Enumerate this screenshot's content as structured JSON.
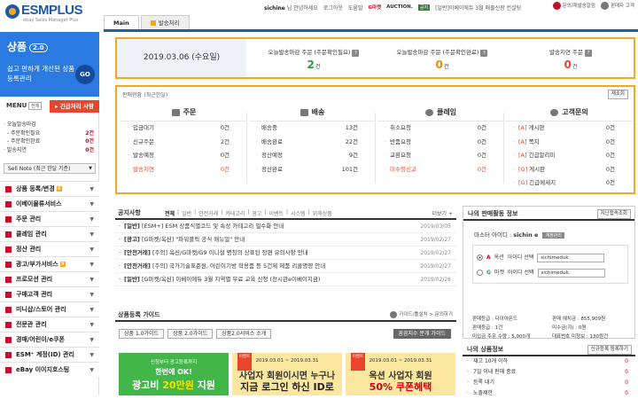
{
  "header": {
    "logo": "ESMPLUS",
    "logo_sub": "ebay Sales Manager Plus",
    "user": "sichine",
    "greeting": "님 안녕하세요",
    "logout": "로그아웃",
    "help": "도움말",
    "partners": [
      "G마켓",
      "AUCTION."
    ],
    "notice_tag": "공지",
    "notice_text": "[일반]이베이에듀 3월 매출신장 컨설팅",
    "links": [
      "문의/재발송알림",
      "판매자 고객"
    ]
  },
  "tabs": [
    {
      "label": "Main",
      "active": true
    },
    {
      "label": "발송처리",
      "active": false
    }
  ],
  "sidebar": {
    "promo_title": "상품",
    "promo_version": "2.0",
    "promo_text": "쉽고 편하게 개선된 상품 등록관리",
    "promo_go": "GO",
    "menu_label": "MENU",
    "menu_all": "전체",
    "urgent": "긴급처리 사항",
    "counts": [
      {
        "label": "· 오늘발송마감",
        "value": "",
        "indent": false
      },
      {
        "label": "- 주문확인필요",
        "value": "2건",
        "indent": true
      },
      {
        "label": "- 주문확인완료",
        "value": "0건",
        "indent": true
      },
      {
        "label": "· 발송지연",
        "value": "0건",
        "indent": false
      }
    ],
    "sell_note": "Sell Note (최근 한달 기준)",
    "menu": [
      {
        "label": "상품 등록/변경",
        "badge": true
      },
      {
        "label": "이베이물류서비스",
        "badge": false
      },
      {
        "label": "주문 관리",
        "badge": false
      },
      {
        "label": "클레임 관리",
        "badge": false
      },
      {
        "label": "정산 관리",
        "badge": false
      },
      {
        "label": "광고/부가서비스",
        "badge": true
      },
      {
        "label": "프로모션 관리",
        "badge": false
      },
      {
        "label": "구매고객 관리",
        "badge": false
      },
      {
        "label": "미니샵/스토어 관리",
        "badge": false
      },
      {
        "label": "전문관 관리",
        "badge": false
      },
      {
        "label": "경매/어린이/e쿠폰",
        "badge": false
      },
      {
        "label": "ESM⁺ 계정(ID) 관리",
        "badge": false
      },
      {
        "label": "eBay 이이지호스팅",
        "badge": false
      }
    ]
  },
  "summary": {
    "date": "2019.03.06 (수요일)",
    "boxes": [
      {
        "label": "오늘발송마감 주문 (주문확인필요)",
        "value": "2",
        "unit": "건",
        "color": "green"
      },
      {
        "label": "오늘발송마감 주문 (주문확인완료)",
        "value": "0",
        "unit": "건",
        "color": "orange"
      },
      {
        "label": "발송지연 주문",
        "value": "0",
        "unit": "건",
        "color": "red"
      }
    ]
  },
  "sales": {
    "title": "판매현황",
    "title_sub": "(최근한달)",
    "refresh": "재조회",
    "columns": [
      {
        "head": "주문",
        "rows": [
          [
            "입금대기",
            "0건"
          ],
          [
            "신규주문",
            "2건"
          ],
          [
            "발송예정",
            "0건"
          ],
          [
            "발송지연",
            "0건"
          ]
        ],
        "red_last": true
      },
      {
        "head": "배송",
        "rows": [
          [
            "배송중",
            "13건"
          ],
          [
            "배송완료",
            "22건"
          ],
          [
            "정산예정",
            "9건"
          ],
          [
            "정산완료",
            "101건"
          ]
        ],
        "red_last": false
      },
      {
        "head": "클레임",
        "rows": [
          [
            "취소요청",
            "0건"
          ],
          [
            "반품요청",
            "0건"
          ],
          [
            "교환요청",
            "0건"
          ],
          [
            "미수령신고",
            "0건"
          ]
        ],
        "red_last": true
      },
      {
        "head": "고객문의",
        "rows": [
          [
            "[A] 게시판",
            "0건"
          ],
          [
            "[A] 쪽지",
            "0건"
          ],
          [
            "[A] 긴급알리미",
            "0건"
          ],
          [
            "[G] 게시판",
            "0건"
          ],
          [
            "[G] 긴급메세지",
            "0건"
          ]
        ],
        "red_last": false
      }
    ]
  },
  "notice": {
    "title": "공지사항",
    "categories": [
      "전체",
      "일반",
      "안전거래",
      "카테고리",
      "광고",
      "이벤트",
      "시스템",
      "위해상품"
    ],
    "more": "더보기 +",
    "items": [
      {
        "cat": "[일반]",
        "text": "[ESM+] ESM 상품식별코드 및 속성 카테고리 필수화 안내",
        "date": "2019/03/05"
      },
      {
        "cat": "[광고]",
        "text": "[G마켓/옥션] \"파워클릭 공식 매뉴얼\" 안내",
        "date": "2019/02/27"
      },
      {
        "cat": "[안전거래]",
        "text": "[주의] 옥션/G마켓/G9 이니셜 명칭의 상표된 장편 유의사항 안내",
        "date": "2019/02/27"
      },
      {
        "cat": "[안전거래]",
        "text": "[주의] 국가기술표준원, 어린이기방 학용품 등 5건제 제품 리콜명령 안내",
        "date": "2019/02/27"
      },
      {
        "cat": "[일반]",
        "text": "[G마켓/옥션] 이베이에듀 3월 지역별 무료 교육 신청 (전시관e이베이지금)",
        "date": "2019/02/26"
      }
    ]
  },
  "guide": {
    "title": "상품등록 가이드",
    "right": "가이드/툴설치 > 문의하기",
    "buttons": [
      "상품 1.0가이드",
      "상품 2.0가이드",
      "상품2.0서비스 소개"
    ],
    "dark_button": "꼼꼼지수 분개 가이드",
    "banners": [
      {
        "ribbon": "",
        "l1": "신청부터 광고등록까지",
        "l2": "한번에 OK!",
        "l3a": "광고비 ",
        "l3b": "20만원",
        "l3c": " 지원"
      },
      {
        "ribbon": "이벤트",
        "l1": "2019.03.01 ~ 2019.03.31",
        "l2": "사업자 회원이시면 누구나",
        "l3": "지금 로그인 하신 ID로"
      },
      {
        "ribbon": "이벤트",
        "l1": "2019.03.01 ~ 2019.03.31",
        "l2": "옥션 사업자 회원",
        "l3": "50% 쿠폰혜택"
      }
    ]
  },
  "activity": {
    "title": "나의 판매활동 정보",
    "button": "지난접속조회",
    "master_label": "마스터 아이디 :",
    "master_id": "sichin e",
    "master_btn": "계정관리",
    "accounts": [
      {
        "mark": "A",
        "market": "옥션",
        "label": "아이디 선택",
        "value": "sichimeduk",
        "selected": true
      },
      {
        "mark": "G",
        "market": "마켓",
        "label": "아이디 선택",
        "value": "sichimeduk.",
        "selected": false
      }
    ],
    "stats": [
      [
        "판매등급 : 다이아몬드",
        "판매 예치금 : 855,909원"
      ],
      [
        "판매등급 : 1건",
        "미수금(지) : 0원"
      ],
      [
        "미입금 주문 수량 : 5,000개",
        "대표번호 미정보 : 130원건"
      ]
    ]
  },
  "sellinfo": {
    "title": "나의 상품정보",
    "button": "신규등록 등록하기",
    "rows": [
      [
        "재고 10개 이하",
        "0"
      ],
      [
        "7일 이내 판매 종료",
        "0"
      ],
      [
        "등록 대기",
        "0"
      ],
      [
        "노출제한",
        "0"
      ]
    ]
  }
}
